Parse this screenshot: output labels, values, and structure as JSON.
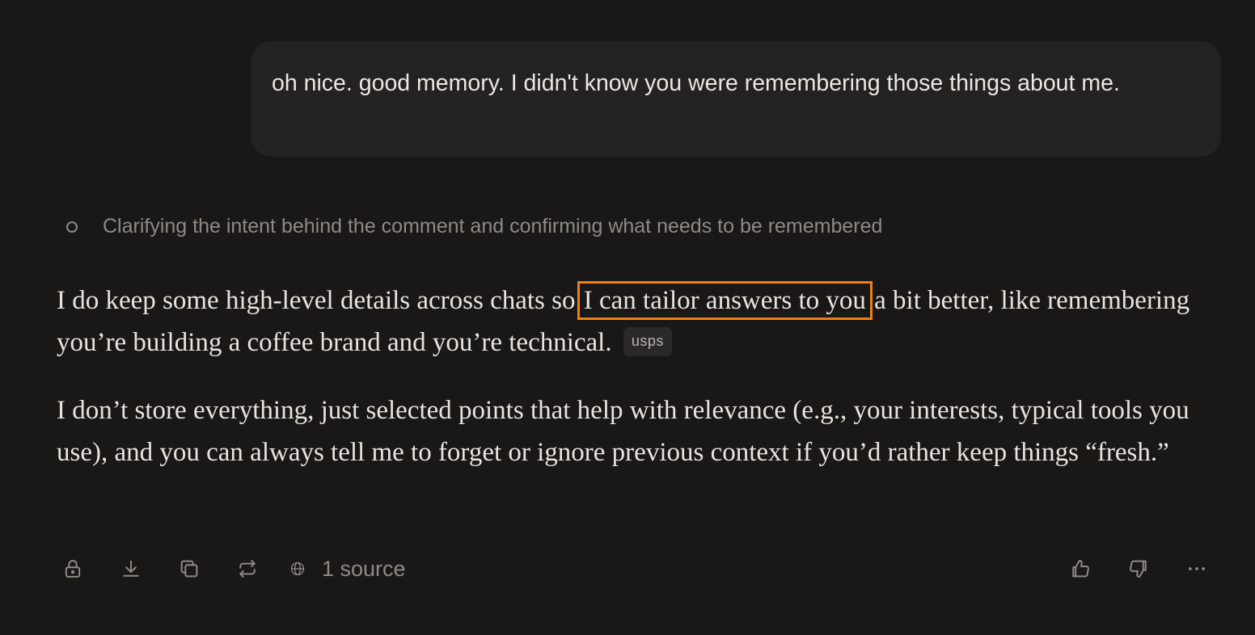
{
  "user_message": {
    "text": "oh nice. good memory. I didn't know you were remembering those things about me."
  },
  "thinking": {
    "status_text": "Clarifying the intent behind the comment and confirming what needs to be remembered"
  },
  "answer": {
    "paragraph1_before": "I do keep some high-level details across chats so ",
    "paragraph1_highlight": "I can tailor answers to you",
    "paragraph1_after": " a bit better, like remembering you’re building a coffee brand and you’re technical.",
    "source_chip": "usps",
    "paragraph2": "I don’t store everything, just selected points that help with relevance (e.g., your interests, typical tools you use), and you can always tell me to forget or ignore previous context if you’d rather keep things “fresh.”",
    "highlight_color": "#f07e16"
  },
  "toolbar": {
    "sources_label": "1 source",
    "icons": [
      "lock-icon",
      "download-icon",
      "copy-icon",
      "repeat-icon",
      "globe-icon",
      "thumbs-up-icon",
      "thumbs-down-icon",
      "more-icon"
    ]
  }
}
